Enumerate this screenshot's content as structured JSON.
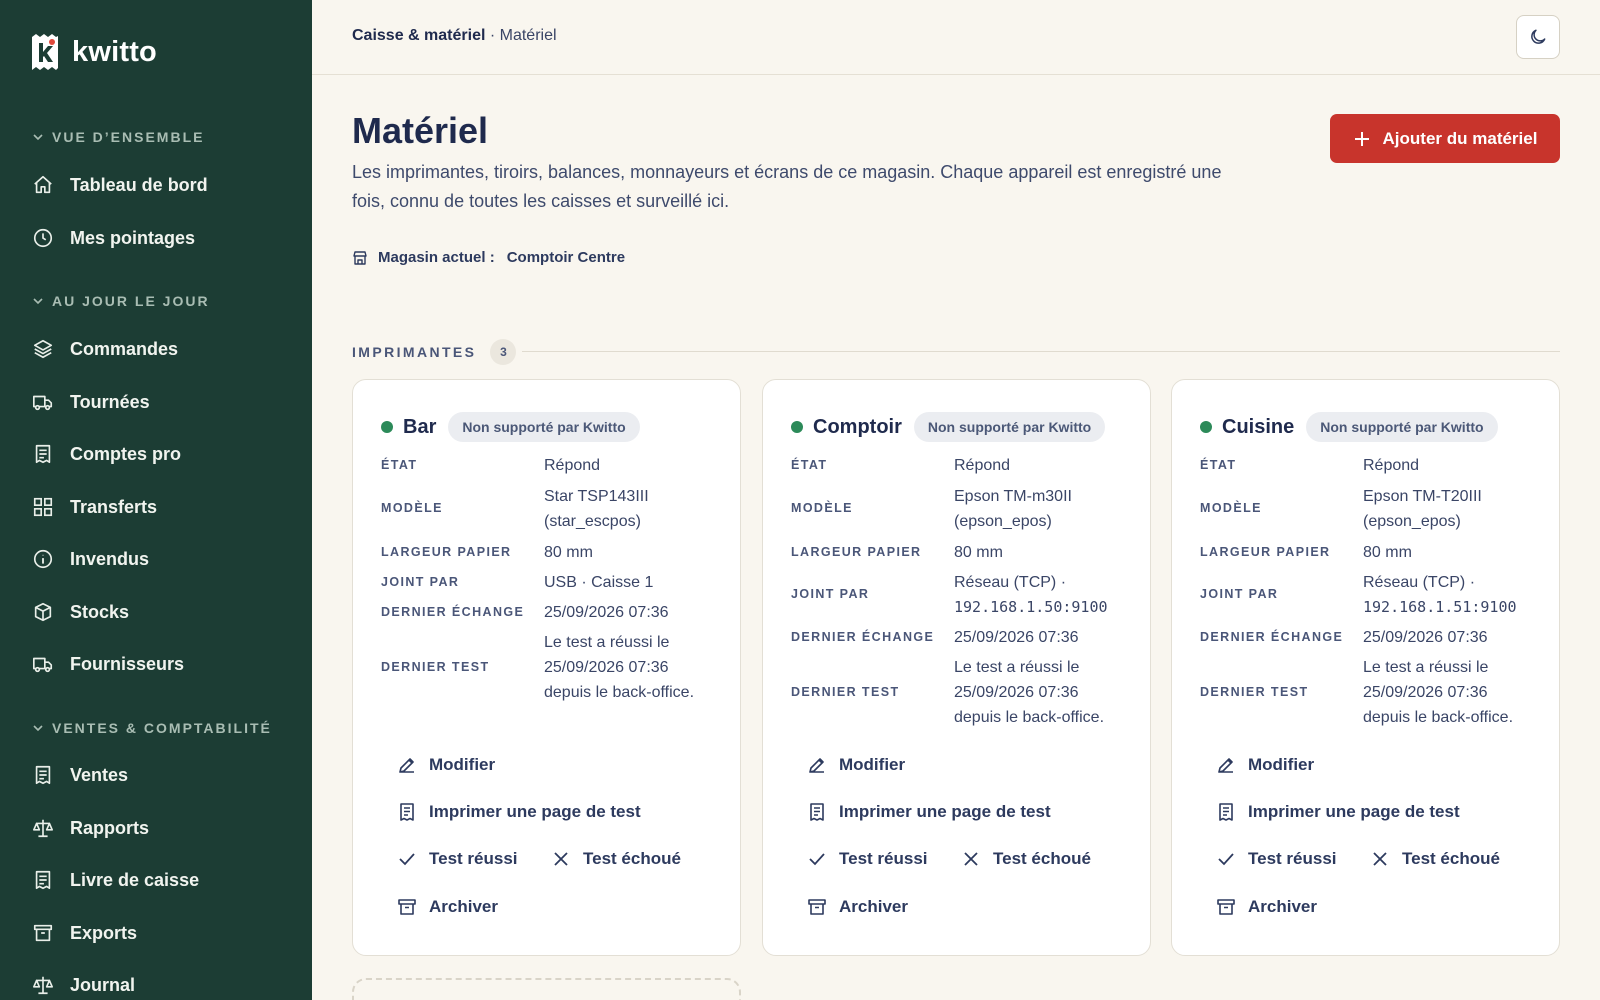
{
  "brand": {
    "name": "kwitto"
  },
  "sidebar": {
    "sections": [
      {
        "label": "VUE D’ENSEMBLE"
      },
      {
        "label": "AU JOUR LE JOUR"
      },
      {
        "label": "VENTES & COMPTABILITÉ"
      }
    ],
    "items": [
      {
        "label": "Tableau de bord",
        "icon": "home-icon"
      },
      {
        "label": "Mes pointages",
        "icon": "clock-icon"
      },
      {
        "label": "Commandes",
        "icon": "layers-icon"
      },
      {
        "label": "Tournées",
        "icon": "truck-icon"
      },
      {
        "label": "Comptes pro",
        "icon": "receipt-icon"
      },
      {
        "label": "Transferts",
        "icon": "grid-icon"
      },
      {
        "label": "Invendus",
        "icon": "info-icon"
      },
      {
        "label": "Stocks",
        "icon": "box-icon"
      },
      {
        "label": "Fournisseurs",
        "icon": "truck-icon"
      },
      {
        "label": "Ventes",
        "icon": "receipt-icon"
      },
      {
        "label": "Rapports",
        "icon": "scale-icon"
      },
      {
        "label": "Livre de caisse",
        "icon": "receipt-icon"
      },
      {
        "label": "Exports",
        "icon": "archive-icon"
      },
      {
        "label": "Journal",
        "icon": "scale-icon"
      }
    ]
  },
  "topbar": {
    "crumb_parent": "Caisse & matériel",
    "crumb_sep": " · ",
    "crumb_current": "Matériel"
  },
  "header": {
    "title": "Matériel",
    "description": "Les imprimantes, tiroirs, balances, monnayeurs et écrans de ce magasin. Chaque appareil est enregistré une fois, connu de toutes les caisses et surveillé ici.",
    "add_button": "Ajouter du matériel",
    "store_label": "Magasin actuel :",
    "store_value": "Comptoir Centre"
  },
  "printers_section": {
    "label": "IMPRIMANTES",
    "count": "3"
  },
  "labels": {
    "state": "ÉTAT",
    "model": "MODÈLE",
    "paper": "LARGEUR PAPIER",
    "joined": "JOINT PAR",
    "last_exchange": "DERNIER ÉCHANGE",
    "last_test": "DERNIER TEST"
  },
  "actions": {
    "edit": "Modifier",
    "print_test": "Imprimer une page de test",
    "test_ok": "Test réussi",
    "test_fail": "Test échoué",
    "archive": "Archiver"
  },
  "cards": [
    {
      "name": "Bar",
      "badge": "Non supporté par Kwitto",
      "status_color": "#2c8a59",
      "state": "Répond",
      "model_line1": "Star TSP143III",
      "model_line2": "(star_escpos)",
      "paper": "80 mm",
      "joined_line1": "USB · Caisse 1",
      "joined_line2": "",
      "last_exchange": "25/09/2026 07:36",
      "last_test": "Le test a réussi le 25/09/2026 07:36 depuis le back-office."
    },
    {
      "name": "Comptoir",
      "badge": "Non supporté par Kwitto",
      "status_color": "#2c8a59",
      "state": "Répond",
      "model_line1": "Epson TM-m30II",
      "model_line2": "(epson_epos)",
      "paper": "80 mm",
      "joined_line1": "Réseau (TCP) ·",
      "joined_line2": "192.168.1.50:9100",
      "last_exchange": "25/09/2026 07:36",
      "last_test": "Le test a réussi le 25/09/2026 07:36 depuis le back-office."
    },
    {
      "name": "Cuisine",
      "badge": "Non supporté par Kwitto",
      "status_color": "#2c8a59",
      "state": "Répond",
      "model_line1": "Epson TM-T20III",
      "model_line2": "(epson_epos)",
      "paper": "80 mm",
      "joined_line1": "Réseau (TCP) ·",
      "joined_line2": "192.168.1.51:9100",
      "last_exchange": "25/09/2026 07:36",
      "last_test": "Le test a réussi le 25/09/2026 07:36 depuis le back-office."
    }
  ]
}
